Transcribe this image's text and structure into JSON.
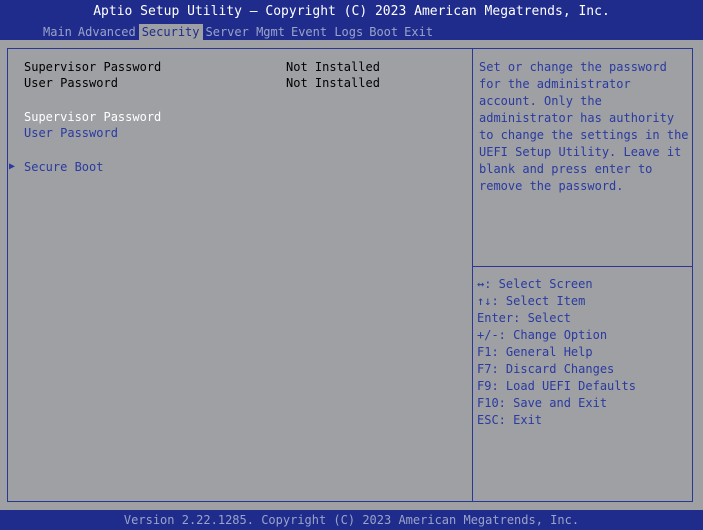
{
  "header": {
    "title": "Aptio Setup Utility – Copyright (C) 2023 American Megatrends, Inc."
  },
  "tabs": [
    {
      "label": "Main"
    },
    {
      "label": "Advanced"
    },
    {
      "label": "Security",
      "active": true
    },
    {
      "label": "Server Mgmt"
    },
    {
      "label": "Event Logs"
    },
    {
      "label": "Boot"
    },
    {
      "label": "Exit"
    }
  ],
  "main": {
    "supervisor_status_label": "Supervisor Password",
    "supervisor_status_value": "Not Installed",
    "user_status_label": "User Password",
    "user_status_value": "Not Installed",
    "supervisor_password_item": "Supervisor Password",
    "user_password_item": "User Password",
    "submenu_arrow": "▶",
    "secure_boot_item": "Secure Boot"
  },
  "help": {
    "text": "Set or change the password for the administrator account. Only the administrator has authority to change the settings in the UEFI Setup Utility. Leave it blank and press enter to remove the password."
  },
  "keys": [
    "↔: Select Screen",
    "↑↓: Select Item",
    "Enter: Select",
    "+/-: Change Option",
    "F1: General Help",
    "F7: Discard Changes",
    "F9: Load UEFI Defaults",
    "F10: Save and Exit",
    "ESC: Exit"
  ],
  "footer": {
    "text": "Version 2.22.1285. Copyright (C) 2023 American Megatrends, Inc."
  },
  "colors": {
    "header_bg": "#1f2c8c",
    "body_bg": "#9ea0a4",
    "highlight_text": "#2a3aa0",
    "selected_text": "#ffffff"
  }
}
